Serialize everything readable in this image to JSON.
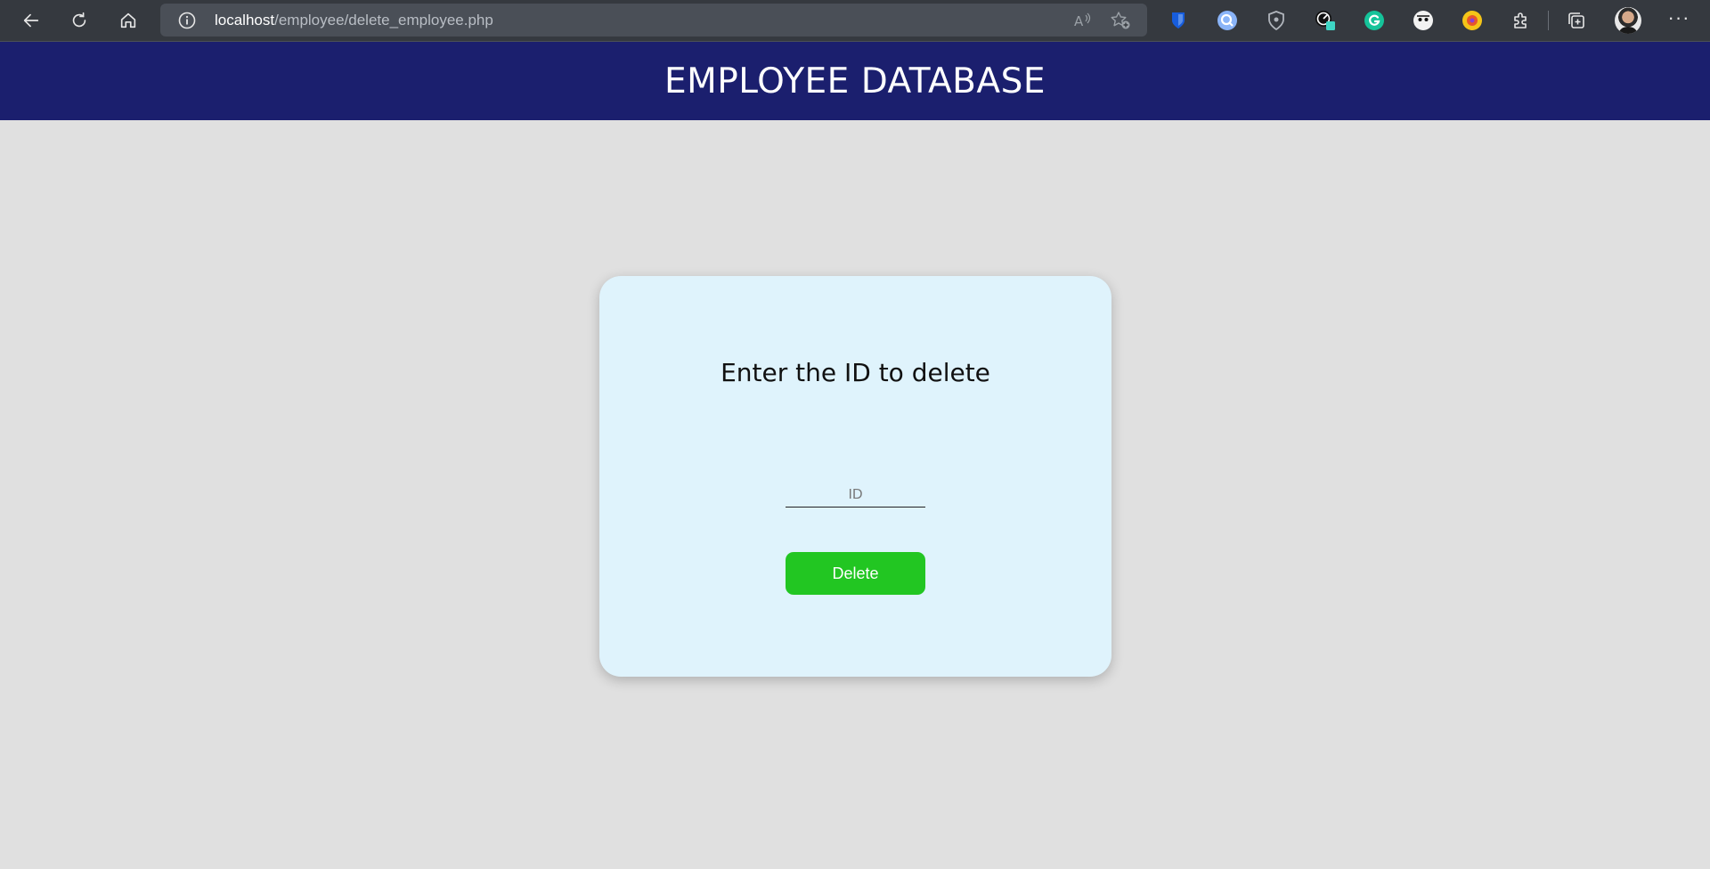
{
  "browser": {
    "url_host": "localhost",
    "url_path": "/employee/delete_employee.php",
    "read_aloud_icon_text": "A⁾",
    "icons": [
      "back-icon",
      "refresh-icon",
      "home-icon",
      "info-icon",
      "read-aloud-icon",
      "favorites-icon",
      "bitwarden-icon",
      "search-extension-icon",
      "shield-extension-icon",
      "speed-extension-icon",
      "grammarly-icon",
      "face-extension-icon",
      "color-extension-icon",
      "extensions-puzzle-icon",
      "collections-icon",
      "more-icon"
    ]
  },
  "header": {
    "title": "EMPLOYEE DATABASE",
    "background": "#1b1f6e"
  },
  "card": {
    "title": "Enter the ID to delete",
    "id_placeholder": "ID",
    "id_value": "",
    "delete_label": "Delete",
    "button_color": "#22c622",
    "background": "#dff3fc"
  }
}
